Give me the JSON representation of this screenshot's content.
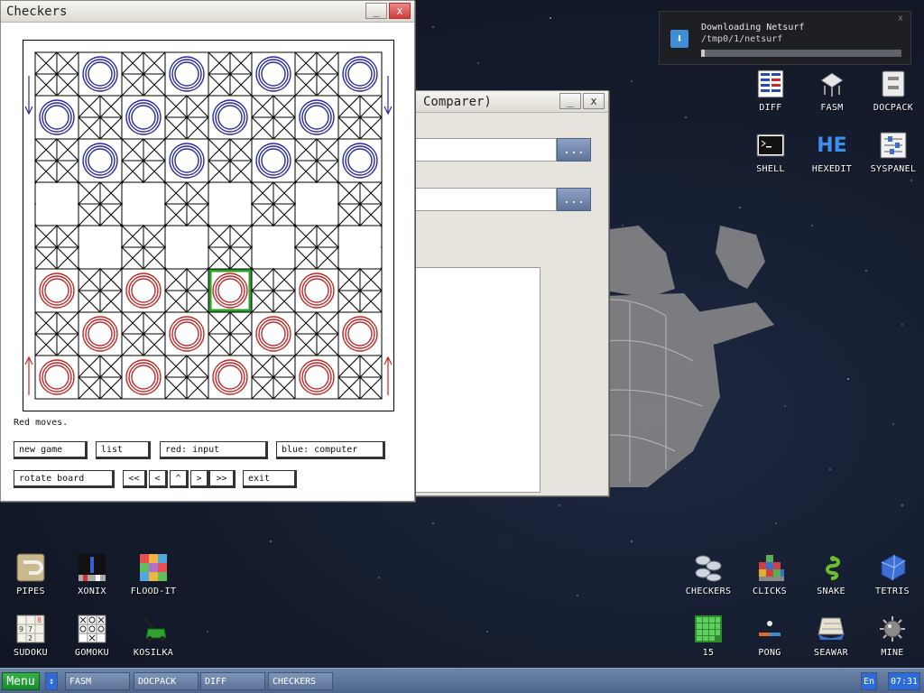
{
  "checkers": {
    "title": "Checkers",
    "min_label": "_",
    "close_label": "x",
    "status": "Red moves.",
    "buttons": {
      "new_game": "new game",
      "list": "list",
      "red": "red: input",
      "blue": "blue: computer",
      "rotate": "rotate board",
      "first": "<<",
      "prev": "<",
      "up": "^",
      "next": ">",
      "last": ">>",
      "exit": "exit"
    },
    "board": {
      "size": 8,
      "blue_pieces": [
        [
          0,
          1
        ],
        [
          0,
          3
        ],
        [
          0,
          5
        ],
        [
          0,
          7
        ],
        [
          1,
          0
        ],
        [
          1,
          2
        ],
        [
          1,
          4
        ],
        [
          1,
          6
        ],
        [
          2,
          1
        ],
        [
          2,
          3
        ],
        [
          2,
          5
        ],
        [
          2,
          7
        ]
      ],
      "red_pieces": [
        [
          5,
          0
        ],
        [
          5,
          2
        ],
        [
          5,
          4
        ],
        [
          5,
          6
        ],
        [
          6,
          1
        ],
        [
          6,
          3
        ],
        [
          6,
          5
        ],
        [
          6,
          7
        ],
        [
          7,
          0
        ],
        [
          7,
          2
        ],
        [
          7,
          4
        ],
        [
          7,
          6
        ]
      ],
      "selected": [
        5,
        4
      ],
      "colors": {
        "blue": "#2a2aa0",
        "red": "#c02828",
        "selected": "#2aa02a",
        "lines": "#000000"
      }
    }
  },
  "comparer": {
    "title": "Comparer)",
    "min_label": "_",
    "close_label": "x",
    "browse_label": "..."
  },
  "notification": {
    "title": "Downloading Netsurf",
    "path": "/tmp0/1/netsurf",
    "progress": 0.02,
    "close": "x"
  },
  "desktop_icons": {
    "diff": "DIFF",
    "fasm": "FASM",
    "docpack": "DOCPACK",
    "shell": "SHELL",
    "hexedit": "HEXEDIT",
    "syspanel": "SYSPANEL",
    "pipes": "PIPES",
    "xonix": "XONIX",
    "floodit": "FLOOD-IT",
    "sudoku": "SUDOKU",
    "gomoku": "GOMOKU",
    "kosilka": "KOSILKA",
    "checkers": "CHECKERS",
    "clicks": "CLICKS",
    "snake": "SNAKE",
    "tetris": "TETRIS",
    "fifteen": "15",
    "pong": "PONG",
    "seawar": "SEAWAR",
    "mine": "MINE",
    "hexedit_glyph": "HE",
    "sudoku_digits": [
      "9",
      "7",
      "2",
      "8"
    ]
  },
  "taskbar": {
    "menu": "Menu",
    "up": "↕",
    "tasks": [
      "FASM",
      "DOCPACK",
      "DIFF",
      "CHECKERS"
    ],
    "lang": "En",
    "clock": "07:31"
  }
}
